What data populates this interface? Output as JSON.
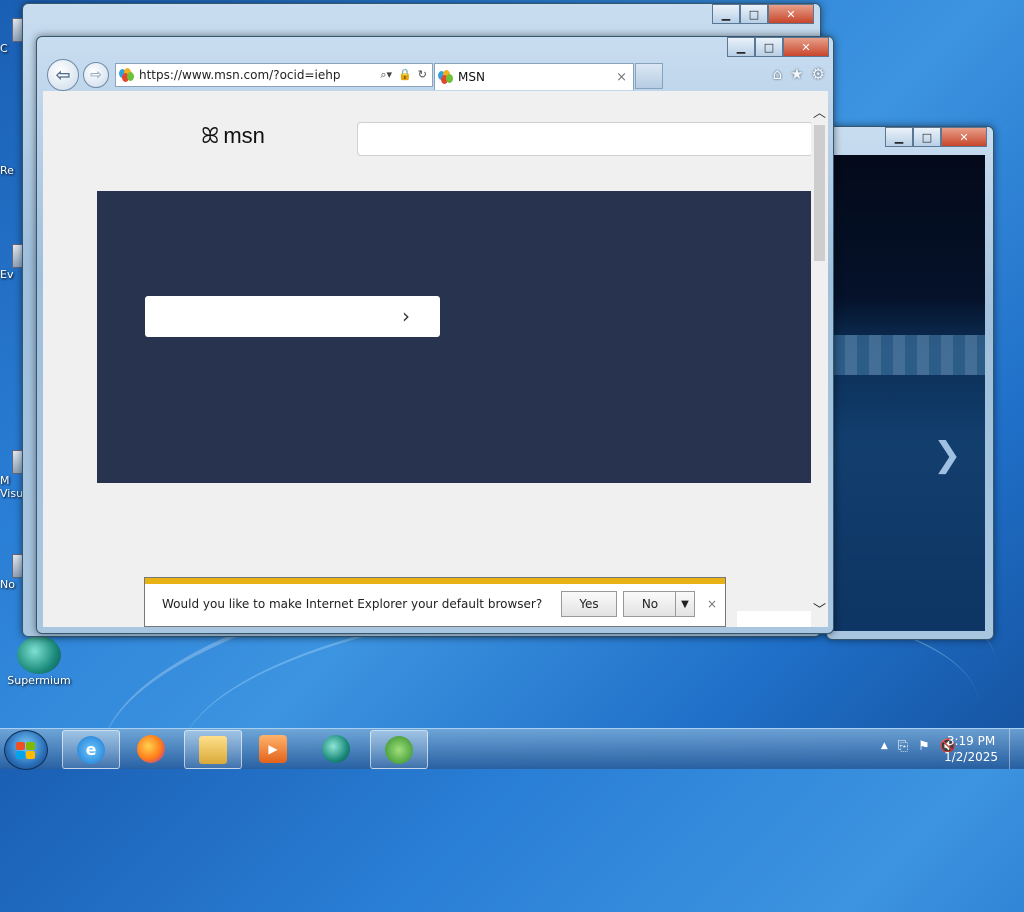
{
  "desktop": {
    "icon_fragments": [
      "C",
      "Re",
      "Ev",
      "M Visu",
      "No"
    ],
    "supermium_label": "Supermium"
  },
  "ie": {
    "address_url": "https://www.msn.com/?ocid=iehp",
    "tab_title": "MSN",
    "tab_close": "×",
    "logo_text": "msn",
    "hero_button_chevron": "›",
    "notification": {
      "message": "Would you like to make Internet Explorer your default browser?",
      "yes_label": "Yes",
      "no_label": "No",
      "dropdown_glyph": "▼",
      "close_glyph": "×"
    }
  },
  "window_controls": {
    "minimize": "▁",
    "maximize": "□",
    "close": "✕"
  },
  "taskbar": {
    "items": [
      "internet-explorer",
      "firefox",
      "file-explorer",
      "media-player",
      "supermium",
      "windows-update"
    ],
    "clock_time": "3:19 PM",
    "clock_date": "1/2/2025",
    "tray_glyphs": [
      "▲",
      "⎘",
      "⚑",
      "🔇"
    ]
  },
  "colors": {
    "hero_bg": "#283350",
    "notif_accent": "#e8b215"
  }
}
